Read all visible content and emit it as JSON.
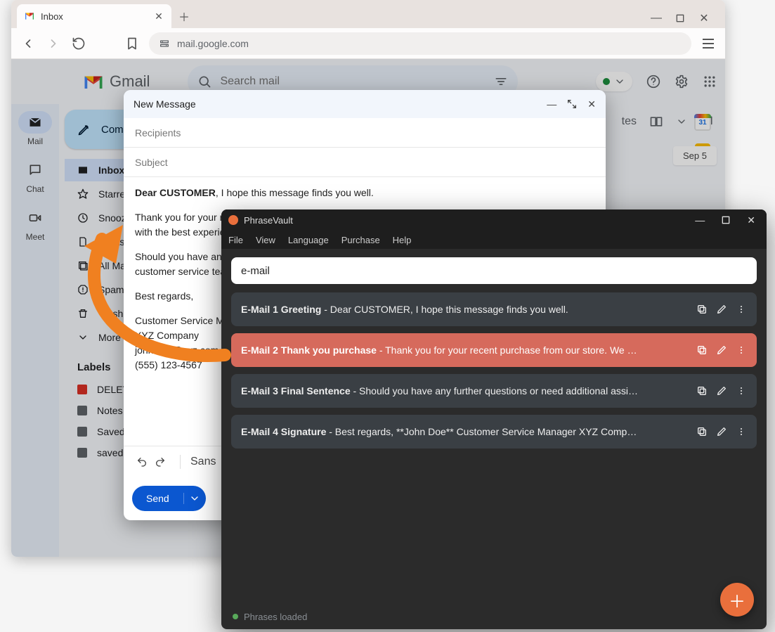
{
  "browser": {
    "tab_title": "Inbox",
    "url": "mail.google.com"
  },
  "gmail": {
    "logo_text": "Gmail",
    "search_placeholder": "Search mail",
    "rail": {
      "mail": "Mail",
      "chat": "Chat",
      "meet": "Meet"
    },
    "compose_label": "Compose",
    "folders": {
      "inbox": "Inbox",
      "starred": "Starred",
      "snoozed": "Snoozed",
      "drafts": "Drafts",
      "all": "All Mail",
      "spam": "Spam",
      "trash": "Trash",
      "more": "More"
    },
    "labels_title": "Labels",
    "labels": [
      "DELETE",
      "Notes",
      "Saved",
      "saved"
    ],
    "topbar": {
      "right_count_label": "tes"
    },
    "date_chip": "Sep 5"
  },
  "compose": {
    "title": "New Message",
    "recipients_label": "Recipients",
    "subject_label": "Subject",
    "body": {
      "greeting_b": "Dear CUSTOMER",
      "greeting_tail": ", I hope this message finds you well.",
      "p2": "Thank you for your recent purchase! We appreciate your business and are committed to providing you with the best experience.",
      "p3": "Should you have any questions or need additional assistance, please do not hesitate to reach out to our customer service team.",
      "p4": "Best regards,",
      "sig1": "Customer Service Manager",
      "sig2": "XYZ Company",
      "sig3": "john.doe@xyz.com",
      "sig4": "(555) 123-4567"
    },
    "font_label": "Sans",
    "send_label": "Send"
  },
  "phrasevault": {
    "title": "PhraseVault",
    "menu": [
      "File",
      "View",
      "Language",
      "Purchase",
      "Help"
    ],
    "search_value": "e-mail",
    "items": [
      {
        "title": "E-Mail 1 Greeting",
        "body": "Dear CUSTOMER, I hope this message finds you well.",
        "selected": false
      },
      {
        "title": "E-Mail 2 Thank you purchase",
        "body": "Thank you for your recent purchase from our store. We …",
        "selected": true
      },
      {
        "title": "E-Mail 3 Final Sentence",
        "body": "Should you have any further questions or need additional assi…",
        "selected": false
      },
      {
        "title": "E-Mail 4 Signature",
        "body": "Best regards, **John Doe** Customer Service Manager XYZ Comp…",
        "selected": false
      }
    ],
    "footer": "Phrases loaded"
  }
}
